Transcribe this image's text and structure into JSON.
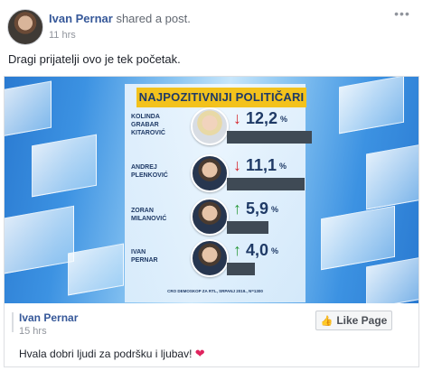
{
  "post": {
    "author": "Ivan Pernar",
    "action": "shared a post.",
    "time": "11 hrs",
    "text": "Dragi prijatelji ovo je tek početak.",
    "more_icon": "more-horizontal-icon"
  },
  "graphic": {
    "title": "NAJPOZITIVNIJI POLITIČARI",
    "source": "CRO DEMOSKOP ZA RTL, SRPANJ 2019., N=1300",
    "politicians": [
      {
        "first": "KOLINDA",
        "middle": "GRABAR",
        "last": "KITAROVIĆ",
        "value": "12,2",
        "trend": "down",
        "trend_color": "#d6262e"
      },
      {
        "first": "ANDREJ",
        "middle": "",
        "last": "PLENKOVIĆ",
        "value": "11,1",
        "trend": "down",
        "trend_color": "#d6262e"
      },
      {
        "first": "ZORAN",
        "middle": "",
        "last": "MILANOVIĆ",
        "value": "5,9",
        "trend": "up",
        "trend_color": "#2b9a3c"
      },
      {
        "first": "IVAN",
        "middle": "",
        "last": "PERNAR",
        "value": "4,0",
        "trend": "up",
        "trend_color": "#2b9a3c"
      }
    ],
    "percent_sign": "%"
  },
  "shared": {
    "page_name": "Ivan Pernar",
    "time": "15 hrs",
    "like_label": "Like Page",
    "caption": "Hvala dobri ljudi za podršku i ljubav!",
    "heart_icon": "heart-icon",
    "thumb_icon": "thumbs-up-icon"
  }
}
